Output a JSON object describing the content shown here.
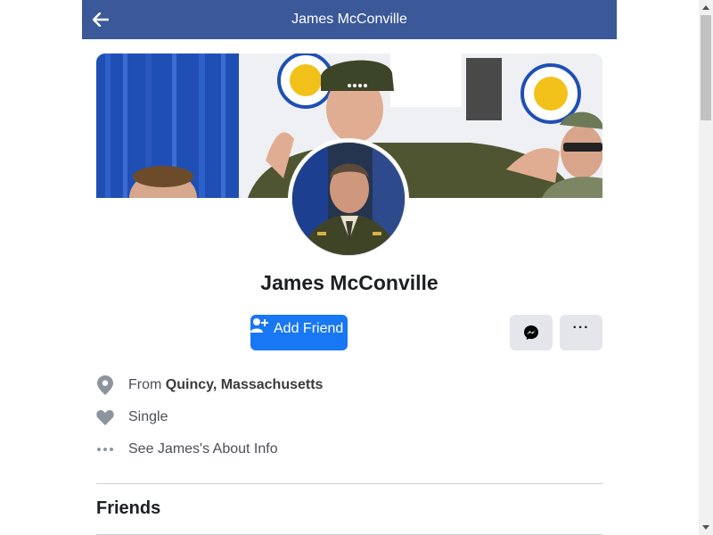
{
  "header": {
    "title": "James McConville",
    "back_icon": "back-arrow-icon"
  },
  "profile": {
    "name": "James McConville"
  },
  "actions": {
    "add_friend_label": "Add Friend",
    "add_friend_icon": "add-person-icon",
    "messenger_icon": "messenger-icon",
    "more_label": "···"
  },
  "info": {
    "from_prefix": "From",
    "from_place": "Quincy, Massachusetts",
    "relationship": "Single",
    "about_link": "See James's About Info"
  },
  "sections": {
    "friends_title": "Friends"
  },
  "colors": {
    "header_bg": "#3b5998",
    "accent": "#1877f2",
    "button_gray": "#e4e6eb"
  }
}
